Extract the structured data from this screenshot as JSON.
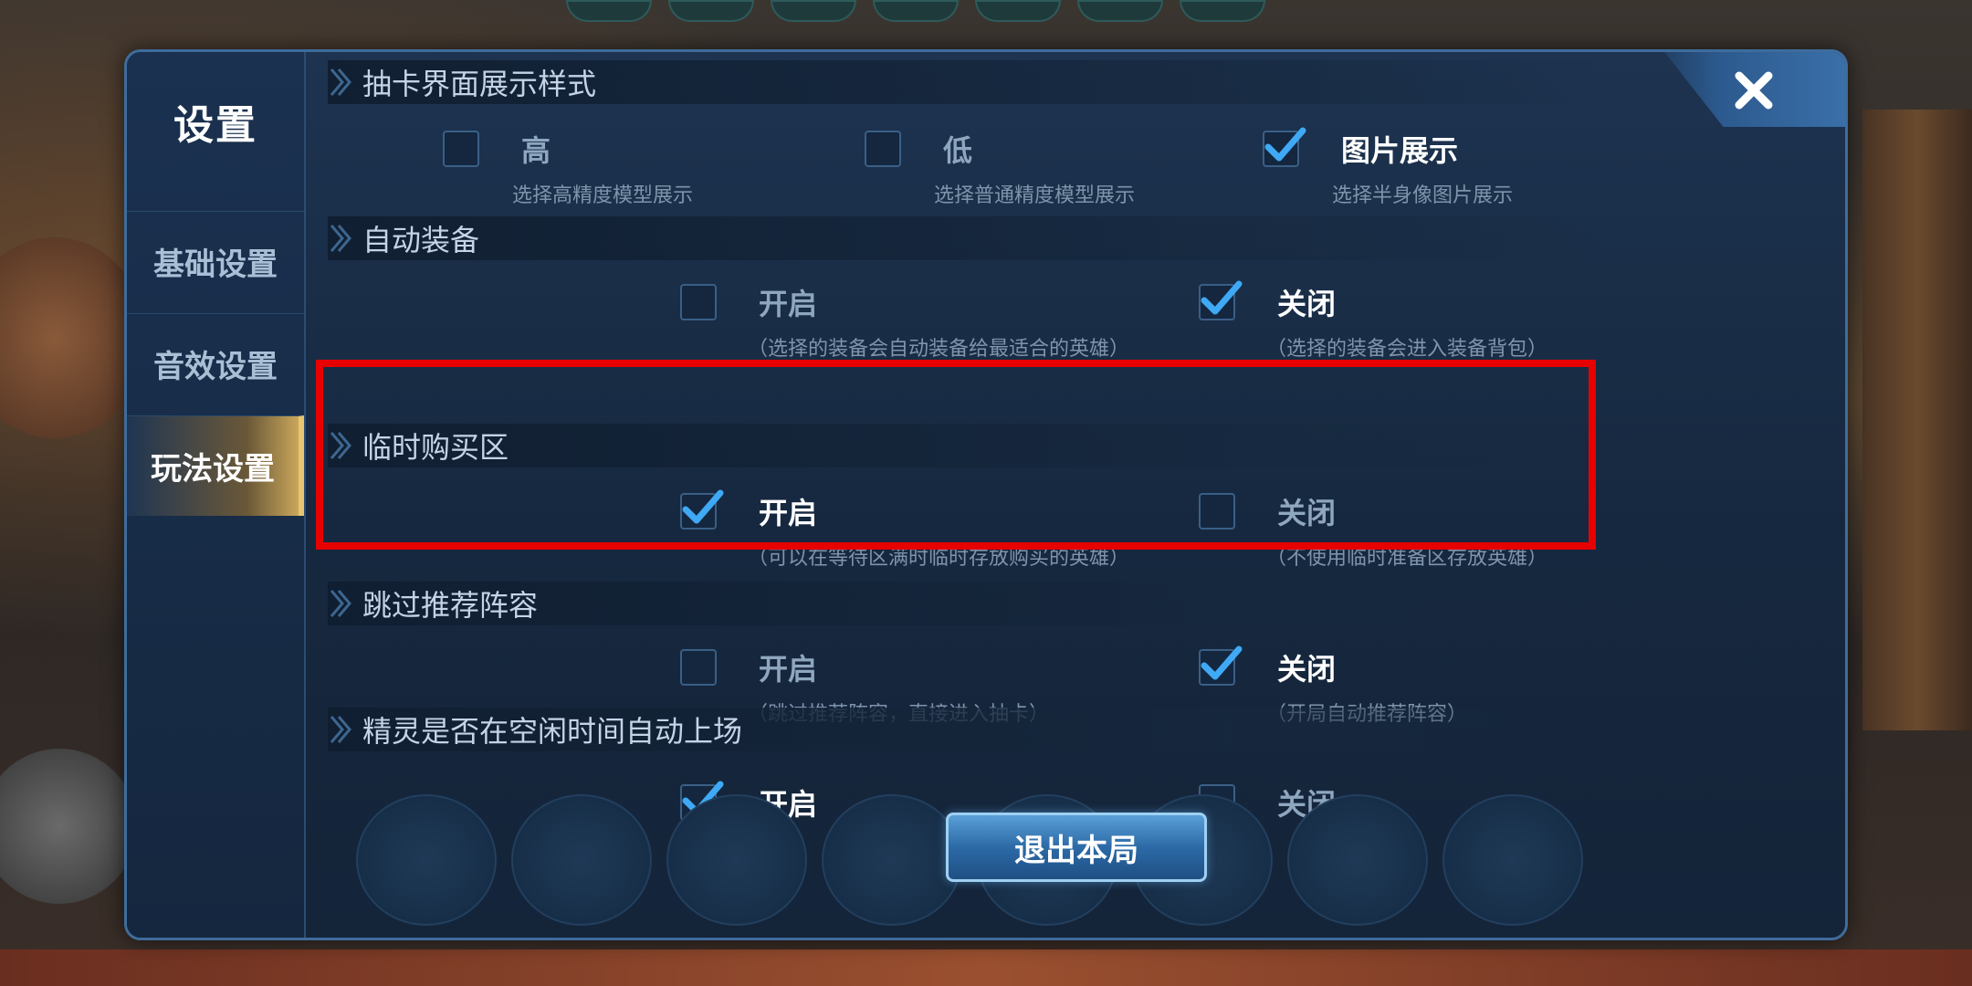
{
  "sidebar": {
    "title": "设置",
    "items": [
      {
        "label": "基础设置",
        "active": false
      },
      {
        "label": "音效设置",
        "active": false
      },
      {
        "label": "玩法设置",
        "active": true
      }
    ]
  },
  "sections": [
    {
      "title": "抽卡界面展示样式",
      "options": [
        {
          "label": "高",
          "desc": "选择高精度模型展示",
          "checked": false
        },
        {
          "label": "低",
          "desc": "选择普通精度模型展示",
          "checked": false
        },
        {
          "label": "图片展示",
          "desc": "选择半身像图片展示",
          "checked": true
        }
      ]
    },
    {
      "title": "自动装备",
      "options": [
        {
          "label": "开启",
          "desc": "（选择的装备会自动装备给最适合的英雄）",
          "checked": false
        },
        {
          "label": "关闭",
          "desc": "（选择的装备会进入装备背包）",
          "checked": true
        }
      ]
    },
    {
      "title": "临时购买区",
      "options": [
        {
          "label": "开启",
          "desc": "（可以在等待区满时临时存放购买的英雄）",
          "checked": true
        },
        {
          "label": "关闭",
          "desc": "（不使用临时准备区存放英雄）",
          "checked": false
        }
      ]
    },
    {
      "title": "跳过推荐阵容",
      "options": [
        {
          "label": "开启",
          "desc": "（跳过推荐阵容，直接进入抽卡）",
          "checked": false
        },
        {
          "label": "关闭",
          "desc": "（开局自动推荐阵容）",
          "checked": true
        }
      ]
    },
    {
      "title": "精灵是否在空闲时间自动上场",
      "options": [
        {
          "label": "开启",
          "desc": "",
          "checked": true
        },
        {
          "label": "关闭",
          "desc": "",
          "checked": false
        }
      ]
    }
  ],
  "exit_button": "退出本局",
  "colors": {
    "panel_bg": "#1d3350",
    "active_tab": "#c9a65a",
    "checkmark": "#3fa9f5",
    "highlight": "#e60000"
  }
}
